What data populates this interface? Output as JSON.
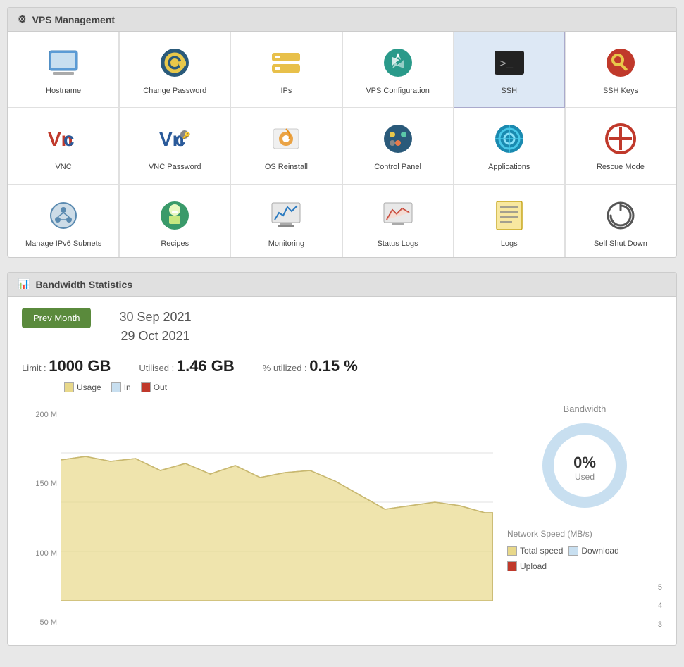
{
  "vpsManagement": {
    "title": "VPS Management",
    "items": [
      {
        "id": "hostname",
        "label": "Hostname",
        "icon": "🖥️",
        "active": false
      },
      {
        "id": "change-password",
        "label": "Change Password",
        "icon": "🔑",
        "active": false
      },
      {
        "id": "ips",
        "label": "IPs",
        "icon": "📡",
        "active": false
      },
      {
        "id": "vps-configuration",
        "label": "VPS Configuration",
        "icon": "🔧",
        "active": false
      },
      {
        "id": "ssh",
        "label": "SSH",
        "icon": ">_",
        "active": true,
        "iconType": "terminal"
      },
      {
        "id": "ssh-keys",
        "label": "SSH Keys",
        "icon": "🗝️",
        "active": false
      },
      {
        "id": "vnc",
        "label": "VNC",
        "icon": "vnc",
        "active": false,
        "iconType": "vnc"
      },
      {
        "id": "vnc-password",
        "label": "VNC Password",
        "icon": "vnc-pw",
        "active": false,
        "iconType": "vnc-password"
      },
      {
        "id": "os-reinstall",
        "label": "OS Reinstall",
        "icon": "⚙️",
        "active": false
      },
      {
        "id": "control-panel",
        "label": "Control Panel",
        "icon": "📊",
        "active": false
      },
      {
        "id": "applications",
        "label": "Applications",
        "icon": "🌐",
        "active": false
      },
      {
        "id": "rescue-mode",
        "label": "Rescue Mode",
        "icon": "🚑",
        "active": false
      },
      {
        "id": "manage-ipv6",
        "label": "Manage IPv6 Subnets",
        "icon": "☁️",
        "active": false
      },
      {
        "id": "recipes",
        "label": "Recipes",
        "icon": "👨‍🍳",
        "active": false
      },
      {
        "id": "monitoring",
        "label": "Monitoring",
        "icon": "📈",
        "active": false
      },
      {
        "id": "status-logs",
        "label": "Status Logs",
        "icon": "📉",
        "active": false
      },
      {
        "id": "logs",
        "label": "Logs",
        "icon": "📋",
        "active": false
      },
      {
        "id": "self-shut-down",
        "label": "Self Shut Down",
        "icon": "⏻",
        "active": false
      }
    ]
  },
  "bandwidth": {
    "title": "Bandwidth Statistics",
    "prevMonthLabel": "Prev Month",
    "dateRange": {
      "start": "30 Sep 2021",
      "end": "29 Oct 2021"
    },
    "limit": {
      "label": "Limit :",
      "value": "1000 GB"
    },
    "utilised": {
      "label": "Utilised :",
      "value": "1.46 GB"
    },
    "percentUtilized": {
      "label": "% utilized :",
      "value": "0.15 %"
    },
    "legend": [
      {
        "label": "Usage",
        "color": "#e8d88a"
      },
      {
        "label": "In",
        "color": "#c8dff0"
      },
      {
        "label": "Out",
        "color": "#c0392b"
      }
    ],
    "chartYLabels": [
      "200 M",
      "150 M",
      "100 M",
      "50 M"
    ],
    "donut": {
      "title": "Bandwidth",
      "percent": "0%",
      "usedLabel": "Used"
    },
    "networkSpeed": {
      "title": "Network Speed (MB/s)",
      "legend": [
        {
          "label": "Total speed",
          "color": "#e8d88a"
        },
        {
          "label": "Download",
          "color": "#c8dff0"
        },
        {
          "label": "Upload",
          "color": "#c0392b"
        }
      ],
      "yLabels": [
        "5",
        "4",
        "3"
      ]
    }
  }
}
